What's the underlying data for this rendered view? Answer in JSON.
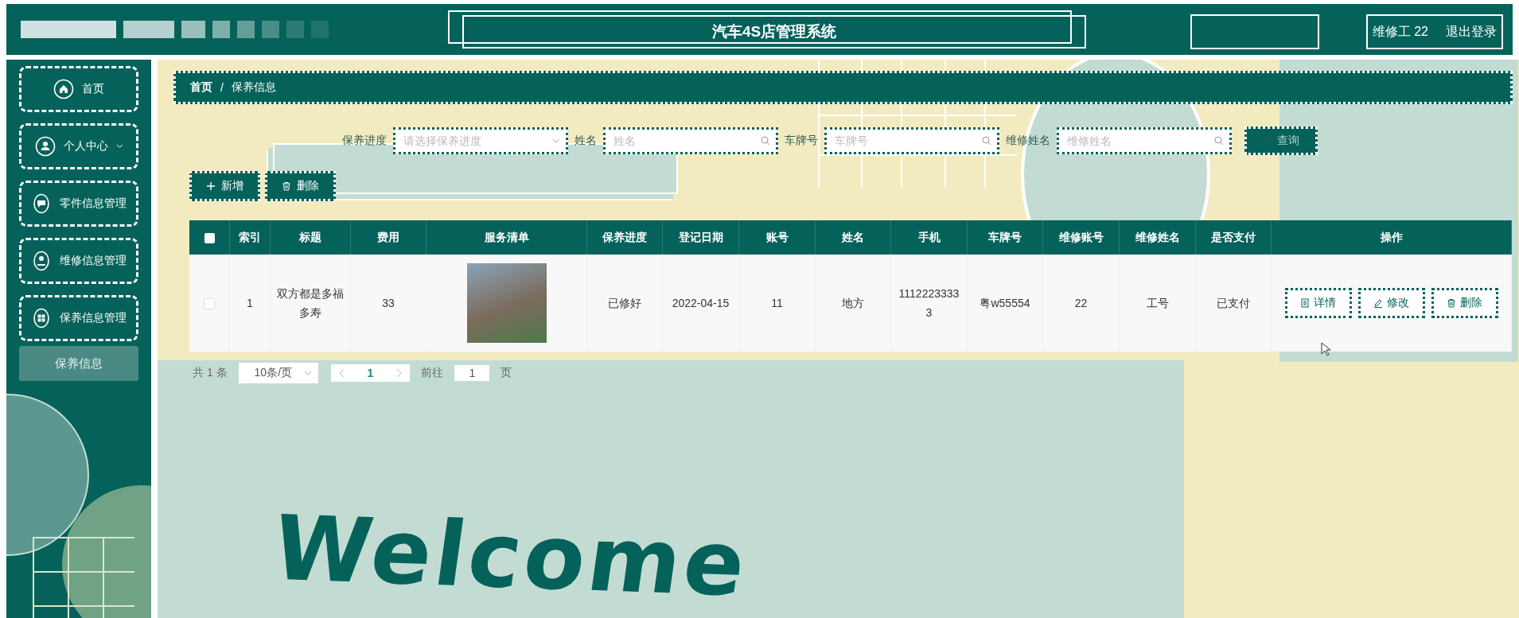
{
  "header": {
    "title": "汽车4S店管理系统",
    "user": "维修工 22",
    "logout": "退出登录"
  },
  "sidebar": {
    "items": [
      {
        "label": "首页",
        "expandable": false
      },
      {
        "label": "个人中心",
        "expandable": true
      },
      {
        "label": "零件信息管理",
        "expandable": false
      },
      {
        "label": "维修信息管理",
        "expandable": false
      },
      {
        "label": "保养信息管理",
        "expandable": false
      }
    ],
    "submenu": [
      {
        "label": "保养信息",
        "selected": true
      }
    ]
  },
  "breadcrumb": {
    "separator": "/",
    "items": [
      "首页",
      "保养信息"
    ]
  },
  "filters": [
    {
      "label": "保养进度",
      "placeholder": "请选择保养进度",
      "kind": "select"
    },
    {
      "label": "姓名",
      "placeholder": "姓名",
      "kind": "search"
    },
    {
      "label": "车牌号",
      "placeholder": "车牌号",
      "kind": "search"
    },
    {
      "label": "维修姓名",
      "placeholder": "维修姓名",
      "kind": "search"
    }
  ],
  "search_button": "查询",
  "actions": [
    {
      "label": "新增",
      "kind": "add"
    },
    {
      "label": "删除",
      "kind": "delete"
    }
  ],
  "table": {
    "all_checked": false,
    "columns": [
      {
        "label": "索引",
        "kind": "text"
      },
      {
        "label": "标题",
        "kind": "text"
      },
      {
        "label": "费用",
        "kind": "text"
      },
      {
        "label": "服务清单",
        "kind": "image"
      },
      {
        "label": "保养进度",
        "kind": "text"
      },
      {
        "label": "登记日期",
        "kind": "text"
      },
      {
        "label": "账号",
        "kind": "text"
      },
      {
        "label": "姓名",
        "kind": "text"
      },
      {
        "label": "手机",
        "kind": "text"
      },
      {
        "label": "车牌号",
        "kind": "text"
      },
      {
        "label": "维修账号",
        "kind": "text"
      },
      {
        "label": "维修姓名",
        "kind": "text"
      },
      {
        "label": "是否支付",
        "kind": "text"
      },
      {
        "label": "操作",
        "kind": "actions"
      }
    ],
    "rows": [
      {
        "checked": false,
        "values": [
          "1",
          "双方都是多福多寿",
          "33",
          "已修好",
          "2022-04-15",
          "11",
          "地方",
          "11122233333",
          "粤w55554",
          "22",
          "工号",
          "已支付"
        ],
        "actions": [
          {
            "label": "详情",
            "kind": "view"
          },
          {
            "label": "修改",
            "kind": "edit"
          },
          {
            "label": "删除",
            "kind": "delete"
          }
        ]
      }
    ]
  },
  "pagination": {
    "total": "共 1 条",
    "page_size": "10条/页",
    "pages": [
      {
        "label": "1",
        "selected": true
      }
    ],
    "goto_label": "前往",
    "goto_value": "1",
    "goto_suffix": "页"
  },
  "welcome": "Welcome"
}
